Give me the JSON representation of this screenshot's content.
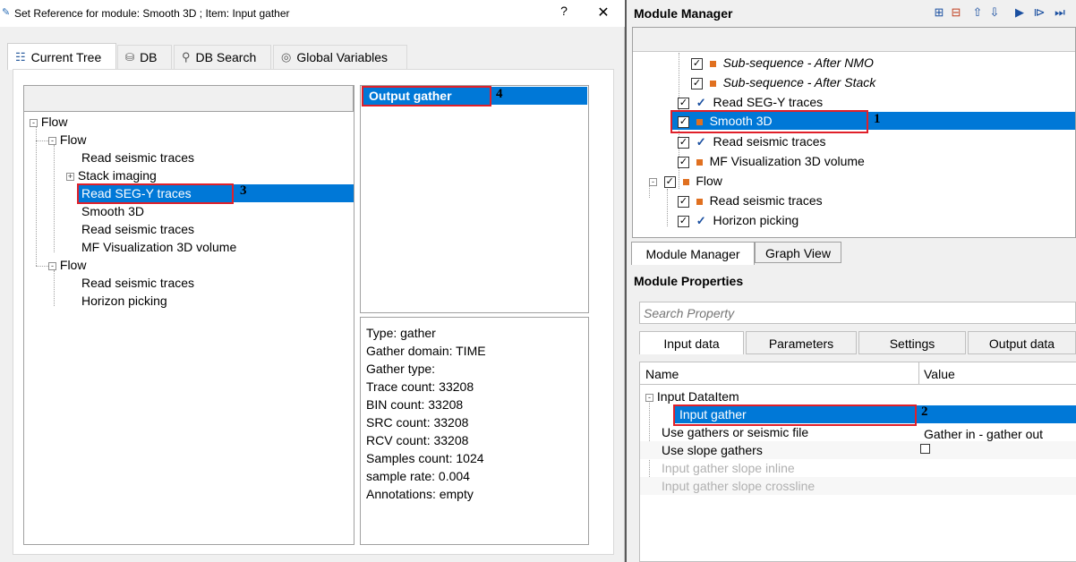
{
  "dialog": {
    "title": "Set Reference for module: Smooth 3D ; Item: Input gather",
    "help": "?",
    "close": "✕",
    "tabs": [
      {
        "label": "Current Tree",
        "icon": "tree-icon"
      },
      {
        "label": "DB",
        "icon": "database-icon"
      },
      {
        "label": "DB Search",
        "icon": "search-icon"
      },
      {
        "label": "Global Variables",
        "icon": "globe-icon"
      }
    ],
    "tree": [
      {
        "label": "Flow",
        "level": 0,
        "expander": "-"
      },
      {
        "label": "Flow",
        "level": 1,
        "expander": "-"
      },
      {
        "label": "Read seismic traces",
        "level": 2
      },
      {
        "label": "Stack imaging",
        "level": 2,
        "expander": "+"
      },
      {
        "label": "Read SEG-Y traces",
        "level": 2,
        "selected": true
      },
      {
        "label": "Smooth 3D",
        "level": 2
      },
      {
        "label": "Read seismic traces",
        "level": 2
      },
      {
        "label": "MF Visualization 3D volume",
        "level": 2
      },
      {
        "label": "Flow",
        "level": 1,
        "expander": "-"
      },
      {
        "label": "Read seismic traces",
        "level": 2
      },
      {
        "label": "Horizon picking",
        "level": 2
      }
    ],
    "outputs": [
      "Output gather"
    ],
    "info": [
      "Type: gather",
      "Gather domain:   TIME",
      "Gather type:",
      "Trace count:   33208",
      "BIN count:      33208",
      "SRC count:      33208",
      "RCV count:      33208",
      "Samples count: 1024",
      "sample rate:  0.004",
      "Annotations:  empty"
    ],
    "markers": {
      "tree": "3",
      "output": "4"
    }
  },
  "module_manager": {
    "title": "Module Manager",
    "toolbar_icons": [
      "add-module-icon",
      "remove-module-icon",
      "move-up-icon",
      "move-down-icon",
      "run-icon",
      "run-step-icon",
      "run-all-icon"
    ],
    "tree": [
      {
        "label": "Sub-sequence - After NMO",
        "italic": true,
        "mark": "square"
      },
      {
        "label": "Sub-sequence - After Stack",
        "italic": true,
        "mark": "square"
      },
      {
        "label": "Read SEG-Y traces",
        "mark": "check"
      },
      {
        "label": "Smooth 3D",
        "mark": "square",
        "selected": true
      },
      {
        "label": "Read seismic traces",
        "mark": "check"
      },
      {
        "label": "MF Visualization 3D volume",
        "mark": "square"
      },
      {
        "label": "Flow",
        "mark": "square",
        "flow": true
      },
      {
        "label": "Read seismic traces",
        "mark": "square"
      },
      {
        "label": "Horizon picking",
        "mark": "check"
      }
    ],
    "marker": "1",
    "bottom_tabs": [
      "Module Manager",
      "Graph View"
    ]
  },
  "module_properties": {
    "title": "Module Properties",
    "search_placeholder": "Search Property",
    "tabs": [
      "Input data",
      "Parameters",
      "Settings",
      "Output data"
    ],
    "columns": [
      "Name",
      "Value"
    ],
    "group": "Input DataItem",
    "rows": [
      {
        "name": "Input gather",
        "value": "",
        "selected": true
      },
      {
        "name": "Use gathers or seismic file",
        "value": "Gather in - gather out"
      },
      {
        "name": "Use slope gathers",
        "value": "checkbox"
      },
      {
        "name": "Input gather slope inline",
        "value": "",
        "disabled": true
      },
      {
        "name": "Input gather slope crossline",
        "value": "",
        "disabled": true
      }
    ],
    "marker": "2"
  }
}
